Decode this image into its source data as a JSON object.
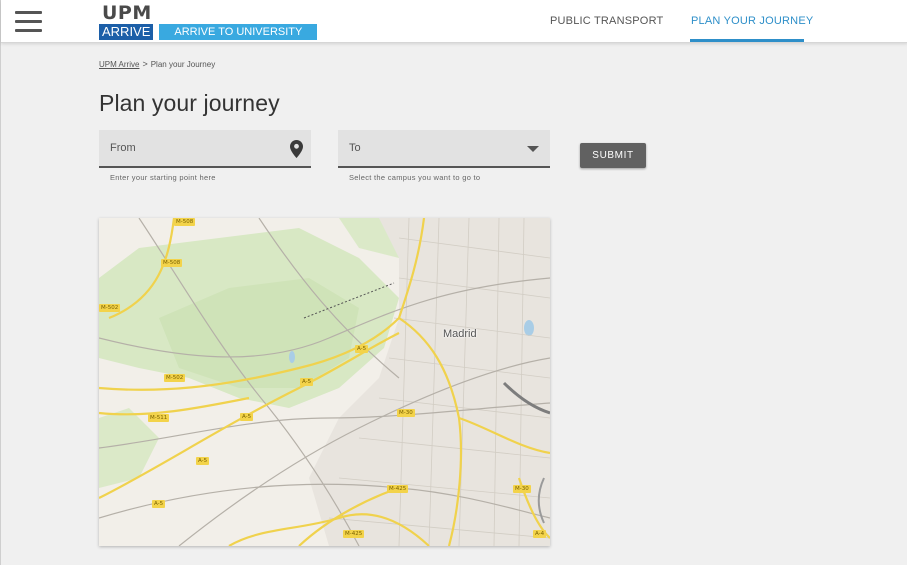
{
  "header": {
    "logo_top": "UPM",
    "logo_arrive": "ARRIVE",
    "logo_tagline": "ARRIVE TO UNIVERSITY",
    "nav": [
      {
        "label": "PUBLIC TRANSPORT",
        "active": false
      },
      {
        "label": "PLAN YOUR JOURNEY",
        "active": true
      }
    ],
    "accent_color": "#2e8fc9"
  },
  "breadcrumb": {
    "home": "UPM Arrive",
    "separator": ">",
    "current": "Plan your Journey"
  },
  "page_title": "Plan your journey",
  "form": {
    "from": {
      "label": "From",
      "value": "",
      "hint": "Enter your starting point here",
      "icon": "map-pin-icon"
    },
    "to": {
      "label": "To",
      "selected": "",
      "hint": "Select the campus you want to go to",
      "icon": "chevron-down-icon"
    },
    "submit_label": "SUBMIT"
  },
  "map": {
    "city_label": "Madrid",
    "road_labels": [
      "M-508",
      "M-508",
      "M-502",
      "M-502",
      "M-511",
      "A-5",
      "A-5",
      "A-5",
      "A-5",
      "A-5",
      "M-30",
      "M-425",
      "M-30",
      "M-425",
      "A-4"
    ]
  }
}
